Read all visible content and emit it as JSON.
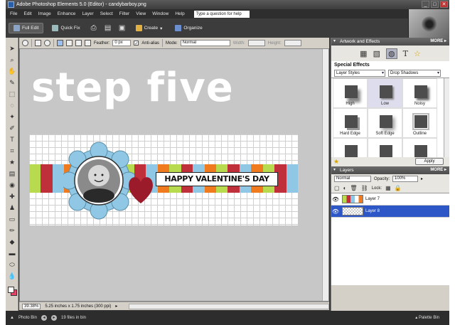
{
  "window": {
    "title": "Adobe Photoshop Elements 5.0 (Editor) - candybarboy.png",
    "controls": [
      "_",
      "□",
      "✕"
    ]
  },
  "menu": [
    "File",
    "Edit",
    "Image",
    "Enhance",
    "Layer",
    "Select",
    "Filter",
    "View",
    "Window",
    "Help"
  ],
  "help_box": "Type a question for help",
  "mode_bar": {
    "full_edit": "Full Edit",
    "quick_fix": "Quick Fix",
    "create": "Create",
    "organize": "Organize"
  },
  "options_bar": {
    "feather_label": "Feather:",
    "feather_value": "0 px",
    "anti_alias": "Anti-alias",
    "mode_label": "Mode:",
    "mode_value": "Normal",
    "width_label": "Width:",
    "height_label": "Height:"
  },
  "canvas": {
    "heading_text": "step five",
    "banner_text": "HAPPY VALENTINE'S DAY",
    "stripe_colors": [
      "#b8da4e",
      "#c0303a",
      "#8fc7e4",
      "#f07b1e",
      "#b8da4e",
      "#c0303a",
      "#8fc7e4",
      "#f07b1e",
      "#b8da4e",
      "#c0303a",
      "#8fc7e4",
      "#f07b1e",
      "#b8da4e",
      "#c0303a",
      "#8fc7e4",
      "#f07b1e",
      "#b8da4e",
      "#c0303a",
      "#8fc7e4",
      "#f07b1e",
      "#b8da4e",
      "#c0303a",
      "#8fc7e4"
    ]
  },
  "status": {
    "zoom": "39.38%",
    "doc_size": "5.25 inches x 1.75 inches (300 ppi)"
  },
  "bin_bar": {
    "photo_bin": "Photo Bin",
    "files_in_bin": "19 files in bin",
    "palette_bin": "Palette Bin"
  },
  "artwork_panel": {
    "title": "Artwork and Effects",
    "more": "MORE ▸",
    "section": "Special Effects",
    "category": "Layer Styles",
    "subcategory": "Drop Shadows",
    "styles": [
      "High",
      "Low",
      "Noisy",
      "Hard Edge",
      "Soft Edge",
      "Outline"
    ],
    "apply": "Apply"
  },
  "layers_panel": {
    "title": "Layers",
    "more": "MORE ▸",
    "blend_mode": "Normal",
    "opacity_label": "Opacity:",
    "opacity_value": "100%",
    "lock_label": "Lock:",
    "layers": [
      {
        "name": "Layer 7",
        "selected": false
      },
      {
        "name": "Layer 8",
        "selected": true
      }
    ]
  }
}
